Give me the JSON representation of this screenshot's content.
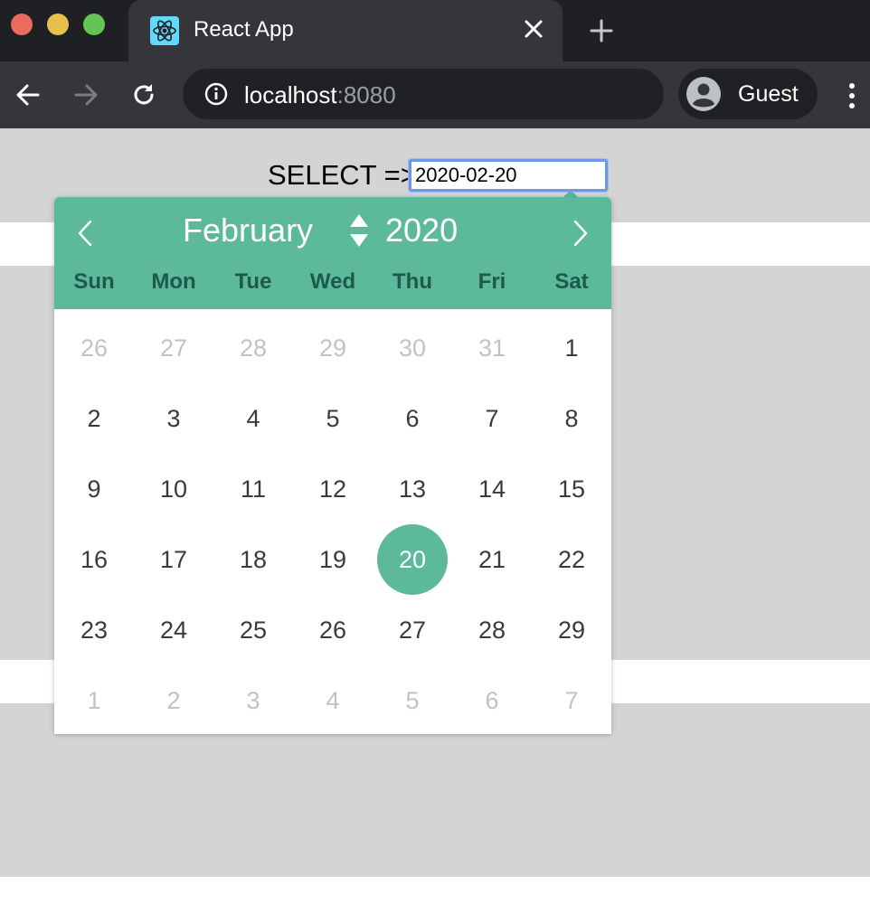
{
  "browser": {
    "tab_title": "React App",
    "url_host": "localhost",
    "url_port": ":8080",
    "profile_label": "Guest",
    "icons": [
      "react-favicon-icon",
      "close-icon",
      "plus-icon",
      "back-arrow-icon",
      "forward-arrow-icon",
      "reload-icon",
      "info-icon",
      "avatar-icon",
      "kebab-menu-icon"
    ]
  },
  "page": {
    "select_label": "SELECT =>",
    "date_value": "2020-02-20"
  },
  "calendar": {
    "month": "February",
    "year": "2020",
    "weekdays": [
      "Sun",
      "Mon",
      "Tue",
      "Wed",
      "Thu",
      "Fri",
      "Sat"
    ],
    "weeks": [
      [
        "26",
        "27",
        "28",
        "29",
        "30",
        "31",
        "1"
      ],
      [
        "2",
        "3",
        "4",
        "5",
        "6",
        "7",
        "8"
      ],
      [
        "9",
        "10",
        "11",
        "12",
        "13",
        "14",
        "15"
      ],
      [
        "16",
        "17",
        "18",
        "19",
        "20",
        "21",
        "22"
      ],
      [
        "23",
        "24",
        "25",
        "26",
        "27",
        "28",
        "29"
      ],
      [
        "1",
        "2",
        "3",
        "4",
        "5",
        "6",
        "7"
      ]
    ],
    "muted_cells": [
      "0-0",
      "0-1",
      "0-2",
      "0-3",
      "0-4",
      "0-5",
      "5-0",
      "5-1",
      "5-2",
      "5-3",
      "5-4",
      "5-5",
      "5-6"
    ],
    "selected_cell": "3-4"
  },
  "colors": {
    "accent": "#5cb99b",
    "weekday_text": "#1e5a49",
    "page_band": "#d4d4d4",
    "chrome_dark": "#1f2023",
    "chrome_toolbar": "#35363a"
  }
}
